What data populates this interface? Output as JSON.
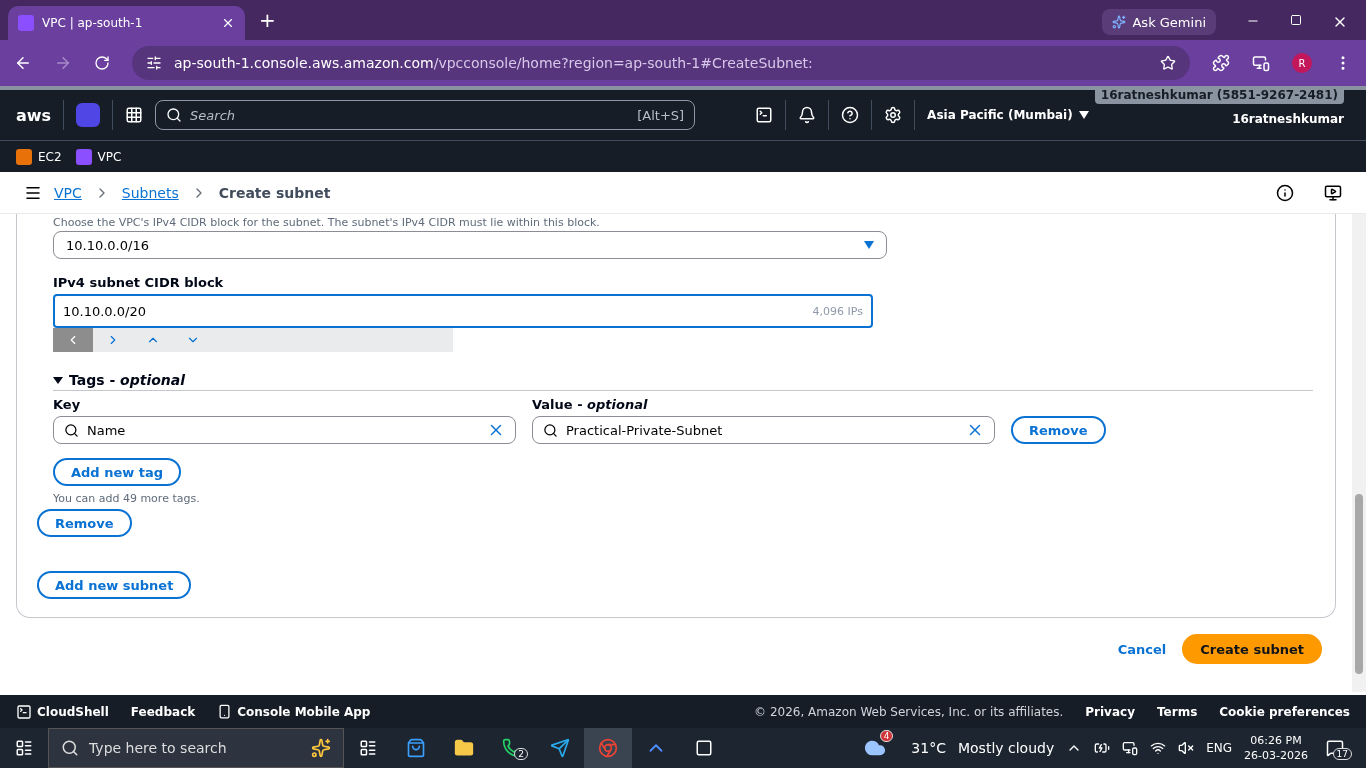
{
  "browser": {
    "tab_title": "VPC | ap-south-1",
    "new_tab": "+",
    "ask_gemini": "Ask Gemini",
    "url_host": "ap-south-1.console.aws.amazon.com",
    "url_path": "/vpcconsole/home?region=ap-south-1#CreateSubnet:",
    "avatar": "R"
  },
  "aws_nav": {
    "logo": "aws",
    "search_placeholder": "Search",
    "shortcut": "[Alt+S]",
    "region": "Asia Pacific (Mumbai)",
    "account": "16ratneshkumar (5851-9267-2481)",
    "user": "16ratneshkumar"
  },
  "favorites": [
    {
      "label": "EC2",
      "color": "#e8710a"
    },
    {
      "label": "VPC",
      "color": "#8c4fff"
    }
  ],
  "breadcrumb": [
    {
      "label": "VPC",
      "link": true
    },
    {
      "label": "Subnets",
      "link": true
    },
    {
      "label": "Create subnet",
      "link": false
    }
  ],
  "form": {
    "vpc_cidr": {
      "hint": "Choose the VPC's IPv4 CIDR block for the subnet. The subnet's IPv4 CIDR must lie within this block.",
      "value": "10.10.0.0/16"
    },
    "subnet_cidr": {
      "label": "IPv4 subnet CIDR block",
      "value": "10.10.0.0/20",
      "count": "4,096 IPs"
    },
    "cidr_nav": [
      {
        "kind": "left",
        "disabled": true
      },
      {
        "kind": "right",
        "disabled": false
      },
      {
        "kind": "up",
        "disabled": false
      },
      {
        "kind": "down",
        "disabled": false
      }
    ],
    "tags": {
      "title": "Tags - *optional*",
      "expanded": true,
      "key_label": "Key",
      "value_label": "Value - *optional*",
      "rows": [
        {
          "key": "Name",
          "value": "Practical-Private-Subnet",
          "remove": "Remove"
        }
      ],
      "add_button": "Add new tag",
      "note": "You can add 49 more tags."
    },
    "remove_subnet": "Remove",
    "add_subnet": "Add new subnet"
  },
  "actions": {
    "cancel": "Cancel",
    "create": "Create subnet"
  },
  "footer": {
    "cloudshell": "CloudShell",
    "feedback": "Feedback",
    "mobile_app": "Console Mobile App",
    "copyright": "© 2026, Amazon Web Services, Inc. or its affiliates.",
    "links": [
      "Privacy",
      "Terms",
      "Cookie preferences"
    ]
  },
  "taskbar": {
    "search_placeholder": "Type here to search",
    "whatsapp_badge": "2",
    "weather_badge": "4",
    "temperature": "31°C",
    "weather": "Mostly cloudy",
    "language": "ENG",
    "time": "06:26 PM",
    "date": "26-03-2026",
    "notifications": "17"
  }
}
